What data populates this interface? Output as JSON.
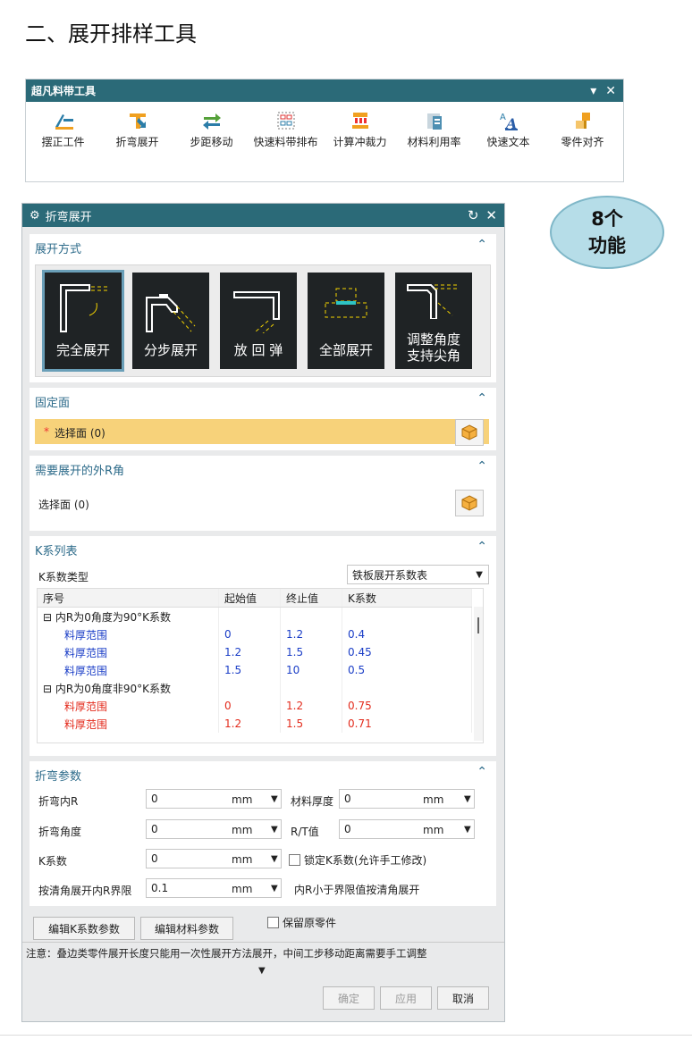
{
  "heading": "二、展开排样工具",
  "ribbon": {
    "title": "超凡料带工具",
    "items": [
      {
        "label": "摆正工件",
        "icon": "align-part-icon"
      },
      {
        "label": "折弯展开",
        "icon": "bend-unfold-icon"
      },
      {
        "label": "步距移动",
        "icon": "step-move-icon"
      },
      {
        "label": "快速料带排布",
        "icon": "strip-layout-icon"
      },
      {
        "label": "计算冲裁力",
        "icon": "punch-force-icon"
      },
      {
        "label": "材料利用率",
        "icon": "material-usage-icon"
      },
      {
        "label": "快速文本",
        "icon": "quick-text-icon"
      },
      {
        "label": "零件对齐",
        "icon": "part-align-icon"
      }
    ]
  },
  "bubble": {
    "line1": "8个",
    "line2": "功能"
  },
  "dialog": {
    "title": "折弯展开",
    "unfold_method": {
      "title": "展开方式",
      "modes": [
        "完全展开",
        "分步展开",
        "放 回 弹",
        "全部展开",
        "调整角度\n支持尖角"
      ]
    },
    "fixed_face": {
      "title": "固定面",
      "select_label": "选择面 (0)",
      "required_mark": "*"
    },
    "outer_r": {
      "title": "需要展开的外R角",
      "select_label": "选择面 (0)"
    },
    "k_table": {
      "title": "K系列表",
      "type_label": "K系数类型",
      "type_value": "铁板展开系数表",
      "columns": [
        "序号",
        "起始值",
        "终止值",
        "K系数"
      ],
      "groups": [
        {
          "name": "内R为0角度为90°K系数",
          "rows": [
            {
              "label": "料厚范围",
              "start": "0",
              "end": "1.2",
              "k": "0.4"
            },
            {
              "label": "料厚范围",
              "start": "1.2",
              "end": "1.5",
              "k": "0.45"
            },
            {
              "label": "料厚范围",
              "start": "1.5",
              "end": "10",
              "k": "0.5"
            }
          ]
        },
        {
          "name": "内R为0角度非90°K系数",
          "rows": [
            {
              "label": "料厚范围",
              "start": "0",
              "end": "1.2",
              "k": "0.75"
            },
            {
              "label": "料厚范围",
              "start": "1.2",
              "end": "1.5",
              "k": "0.71"
            }
          ]
        }
      ]
    },
    "bend_params": {
      "title": "折弯参数",
      "inner_r_label": "折弯内R",
      "inner_r_value": "0",
      "inner_r_unit": "mm",
      "thickness_label": "材料厚度",
      "thickness_value": "0",
      "thickness_unit": "mm",
      "angle_label": "折弯角度",
      "angle_value": "0",
      "angle_unit": "mm",
      "rt_label": "R/T值",
      "rt_value": "0",
      "rt_unit": "mm",
      "k_label": "K系数",
      "k_value": "0",
      "k_unit": "mm",
      "lock_k_label": "锁定K系数(允许手工修改)",
      "clear_label": "按清角展开内R界限",
      "clear_value": "0.1",
      "clear_unit": "mm",
      "clear_note": "内R小于界限值按清角展开"
    },
    "edit_k_button": "编辑K系数参数",
    "edit_material_button": "编辑材料参数",
    "keep_original_label": "保留原零件",
    "note": "注意：叠边类零件展开长度只能用一次性展开方法展开，中间工步移动距离需要手工调整",
    "ok": "确定",
    "apply": "应用",
    "cancel": "取消"
  }
}
